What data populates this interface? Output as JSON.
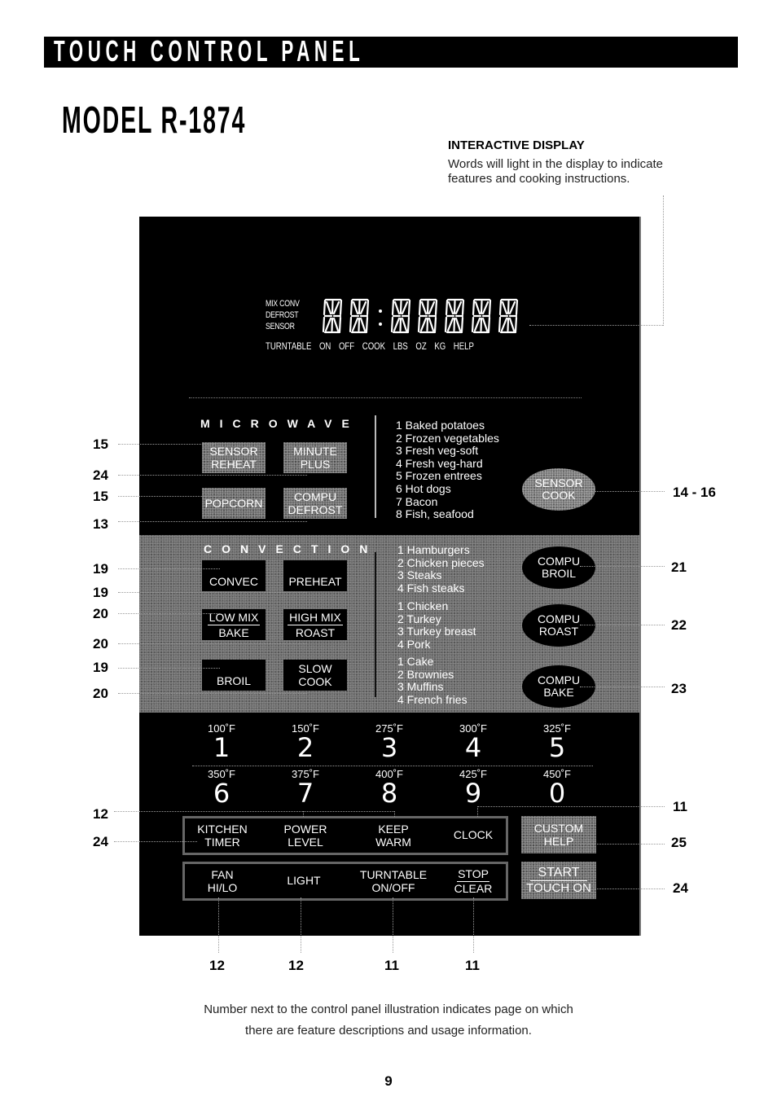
{
  "header": {
    "section_title": "TOUCH CONTROL PANEL",
    "model_title": "MODEL R-1874"
  },
  "interactive_display": {
    "heading": "INTERACTIVE DISPLAY",
    "description": "Words will light in the display to indicate features and cooking instructions."
  },
  "display": {
    "side_labels": [
      "MIX CONV",
      "DEFROST",
      "SENSOR"
    ],
    "bottom_labels": [
      "TURNTABLE",
      "ON",
      "OFF",
      "COOK",
      "LBS",
      "OZ",
      "KG",
      "HELP"
    ],
    "digit_count_left": 2,
    "digit_count_right": 5
  },
  "microwave": {
    "title": "MICROWAVE",
    "keys": [
      {
        "line1": "SENSOR",
        "line2": "REHEAT"
      },
      {
        "line1": "MINUTE",
        "line2": "PLUS"
      },
      {
        "line1": "POPCORN",
        "line2": ""
      },
      {
        "line1": "COMPU",
        "line2": "DEFROST"
      }
    ],
    "sensor_cook_list": [
      "1 Baked potatoes",
      "2 Frozen vegetables",
      "3 Fresh veg-soft",
      "4 Fresh veg-hard",
      "5 Frozen entrees",
      "6 Hot dogs",
      "7 Bacon",
      "8 Fish, seafood"
    ],
    "sensor_cook_key": {
      "line1": "SENSOR",
      "line2": "COOK"
    }
  },
  "convection": {
    "title": "CONVECTION",
    "keys": [
      {
        "line1": "CONVEC",
        "line2": ""
      },
      {
        "line1": "PREHEAT",
        "line2": ""
      },
      {
        "line1": "LOW MIX",
        "line2": "BAKE"
      },
      {
        "line1": "HIGH MIX",
        "line2": "ROAST"
      },
      {
        "line1": "BROIL",
        "line2": ""
      },
      {
        "line1": "SLOW",
        "line2": "COOK"
      }
    ],
    "broil_list": [
      "1 Hamburgers",
      "2 Chicken pieces",
      "3 Steaks",
      "4 Fish steaks"
    ],
    "roast_list": [
      "1 Chicken",
      "2 Turkey",
      "3 Turkey breast",
      "4 Pork"
    ],
    "bake_list": [
      "1 Cake",
      "2 Brownies",
      "3 Muffins",
      "4 French fries"
    ],
    "compu_broil": {
      "line1": "COMPU",
      "line2": "BROIL"
    },
    "compu_roast": {
      "line1": "COMPU",
      "line2": "ROAST"
    },
    "compu_bake": {
      "line1": "COMPU",
      "line2": "BAKE"
    }
  },
  "numpad": [
    {
      "temp": "100˚F",
      "digit": "1"
    },
    {
      "temp": "150˚F",
      "digit": "2"
    },
    {
      "temp": "275˚F",
      "digit": "3"
    },
    {
      "temp": "300˚F",
      "digit": "4"
    },
    {
      "temp": "325˚F",
      "digit": "5"
    },
    {
      "temp": "350˚F",
      "digit": "6"
    },
    {
      "temp": "375˚F",
      "digit": "7"
    },
    {
      "temp": "400˚F",
      "digit": "8"
    },
    {
      "temp": "425˚F",
      "digit": "9"
    },
    {
      "temp": "450˚F",
      "digit": "0"
    }
  ],
  "function_keys_row1": [
    {
      "line1": "KITCHEN",
      "line2": "TIMER"
    },
    {
      "line1": "POWER",
      "line2": "LEVEL"
    },
    {
      "line1": "KEEP",
      "line2": "WARM"
    },
    {
      "line1": "CLOCK",
      "line2": ""
    }
  ],
  "function_keys_row2": [
    {
      "line1": "FAN",
      "line2": "HI/LO"
    },
    {
      "line1": "LIGHT",
      "line2": ""
    },
    {
      "line1": "TURNTABLE",
      "line2": "ON/OFF"
    },
    {
      "line1": "STOP",
      "line2": "CLEAR"
    }
  ],
  "custom_help_key": {
    "line1": "CUSTOM",
    "line2": "HELP"
  },
  "start_key": {
    "line1": "START",
    "line2": "TOUCH ON"
  },
  "callouts": {
    "left": [
      "15",
      "24",
      "15",
      "13",
      "19",
      "19",
      "20",
      "20",
      "19",
      "20",
      "12",
      "24"
    ],
    "right": [
      "14 - 16",
      "21",
      "22",
      "23",
      "11",
      "25",
      "24"
    ],
    "bottom": [
      "12",
      "12",
      "11",
      "11"
    ]
  },
  "footnote": {
    "line1": "Number next to the control panel illustration indicates page on which",
    "line2": "there are feature descriptions and usage information."
  },
  "page_number": "9"
}
